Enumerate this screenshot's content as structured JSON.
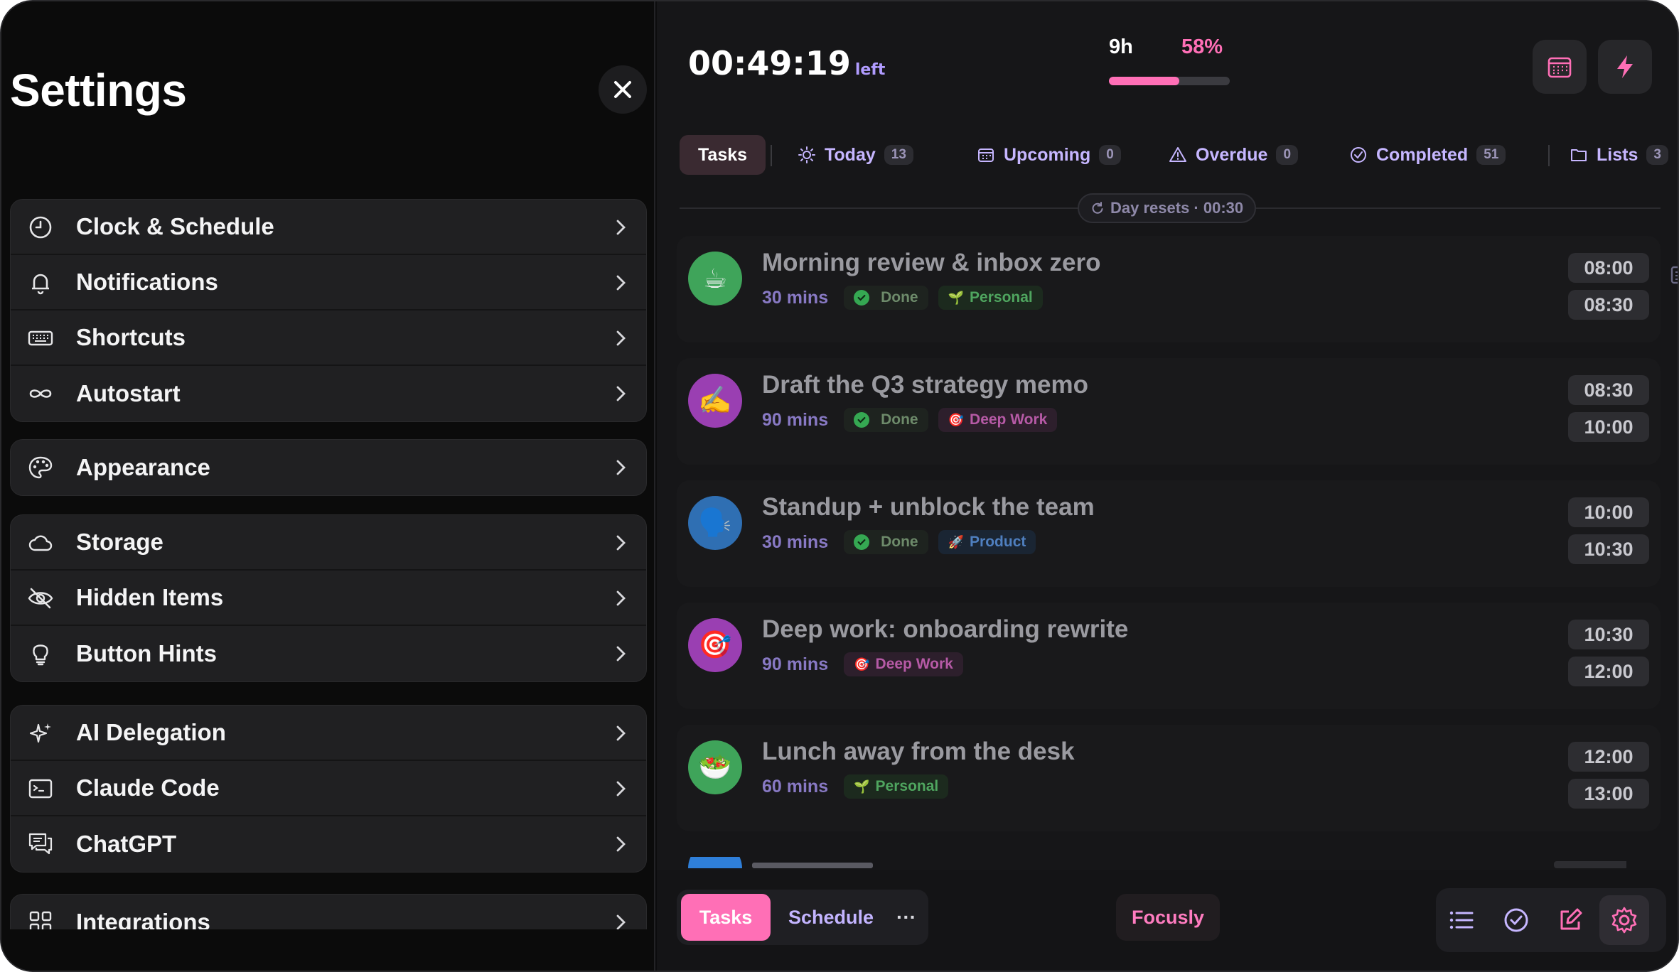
{
  "settings": {
    "title": "Settings",
    "groups": [
      [
        {
          "label": "Clock & Schedule",
          "icon": "clock-icon"
        },
        {
          "label": "Notifications",
          "icon": "bell-icon"
        },
        {
          "label": "Shortcuts",
          "icon": "keyboard-icon"
        },
        {
          "label": "Autostart",
          "icon": "infinity-icon"
        }
      ],
      [
        {
          "label": "Appearance",
          "icon": "palette-icon"
        }
      ],
      [
        {
          "label": "Storage",
          "icon": "cloud-icon"
        },
        {
          "label": "Hidden Items",
          "icon": "eye-slash-icon"
        },
        {
          "label": "Button Hints",
          "icon": "lightbulb-icon"
        }
      ],
      [
        {
          "label": "AI Delegation",
          "icon": "sparkles-icon"
        },
        {
          "label": "Claude Code",
          "icon": "terminal-icon"
        },
        {
          "label": "ChatGPT",
          "icon": "chat-bubbles-icon"
        }
      ],
      [
        {
          "label": "Integrations",
          "icon": "grid-icon"
        }
      ]
    ]
  },
  "header": {
    "timer": "00:49:19",
    "timer_suffix": "left",
    "hours": "9h",
    "percent": "58%",
    "progress_fraction": 0.58
  },
  "tabs": [
    {
      "label": "Tasks",
      "count": ""
    },
    {
      "label": "Today",
      "count": "13"
    },
    {
      "label": "Upcoming",
      "count": "0"
    },
    {
      "label": "Overdue",
      "count": "0"
    },
    {
      "label": "Completed",
      "count": "51"
    },
    {
      "label": "Lists",
      "count": "3"
    }
  ],
  "day_reset": "Day resets · 00:30",
  "tasks": [
    {
      "title": "Morning review & inbox zero",
      "duration": "30 mins",
      "status": "Done",
      "tag": "Personal",
      "tag_emoji": "🌱",
      "start": "08:00",
      "end": "08:30",
      "avatar": "☕",
      "avatar_color": "#3fa45a"
    },
    {
      "title": "Draft the Q3 strategy memo",
      "duration": "90 mins",
      "status": "Done",
      "tag": "Deep Work",
      "tag_emoji": "🎯",
      "start": "08:30",
      "end": "10:00",
      "avatar": "✍️",
      "avatar_color": "#9a3fb2"
    },
    {
      "title": "Standup + unblock the team",
      "duration": "30 mins",
      "status": "Done",
      "tag": "Product",
      "tag_emoji": "🚀",
      "start": "10:00",
      "end": "10:30",
      "avatar": "🗣️",
      "avatar_color": "#2f6fb3"
    },
    {
      "title": "Deep work: onboarding rewrite",
      "duration": "90 mins",
      "status": "",
      "tag": "Deep Work",
      "tag_emoji": "🎯",
      "start": "10:30",
      "end": "12:00",
      "avatar": "🎯",
      "avatar_color": "#9a3fb2"
    },
    {
      "title": "Lunch away from the desk",
      "duration": "60 mins",
      "status": "",
      "tag": "Personal",
      "tag_emoji": "🌱",
      "start": "12:00",
      "end": "13:00",
      "avatar": "🥗",
      "avatar_color": "#3fa45a"
    }
  ],
  "bottom": {
    "tasks_label": "Tasks",
    "schedule_label": "Schedule",
    "more_label": "···",
    "brand": "Focusly"
  },
  "colors": {
    "accent_pink": "#ff6fb6",
    "accent_purple": "#c6b6ff"
  }
}
